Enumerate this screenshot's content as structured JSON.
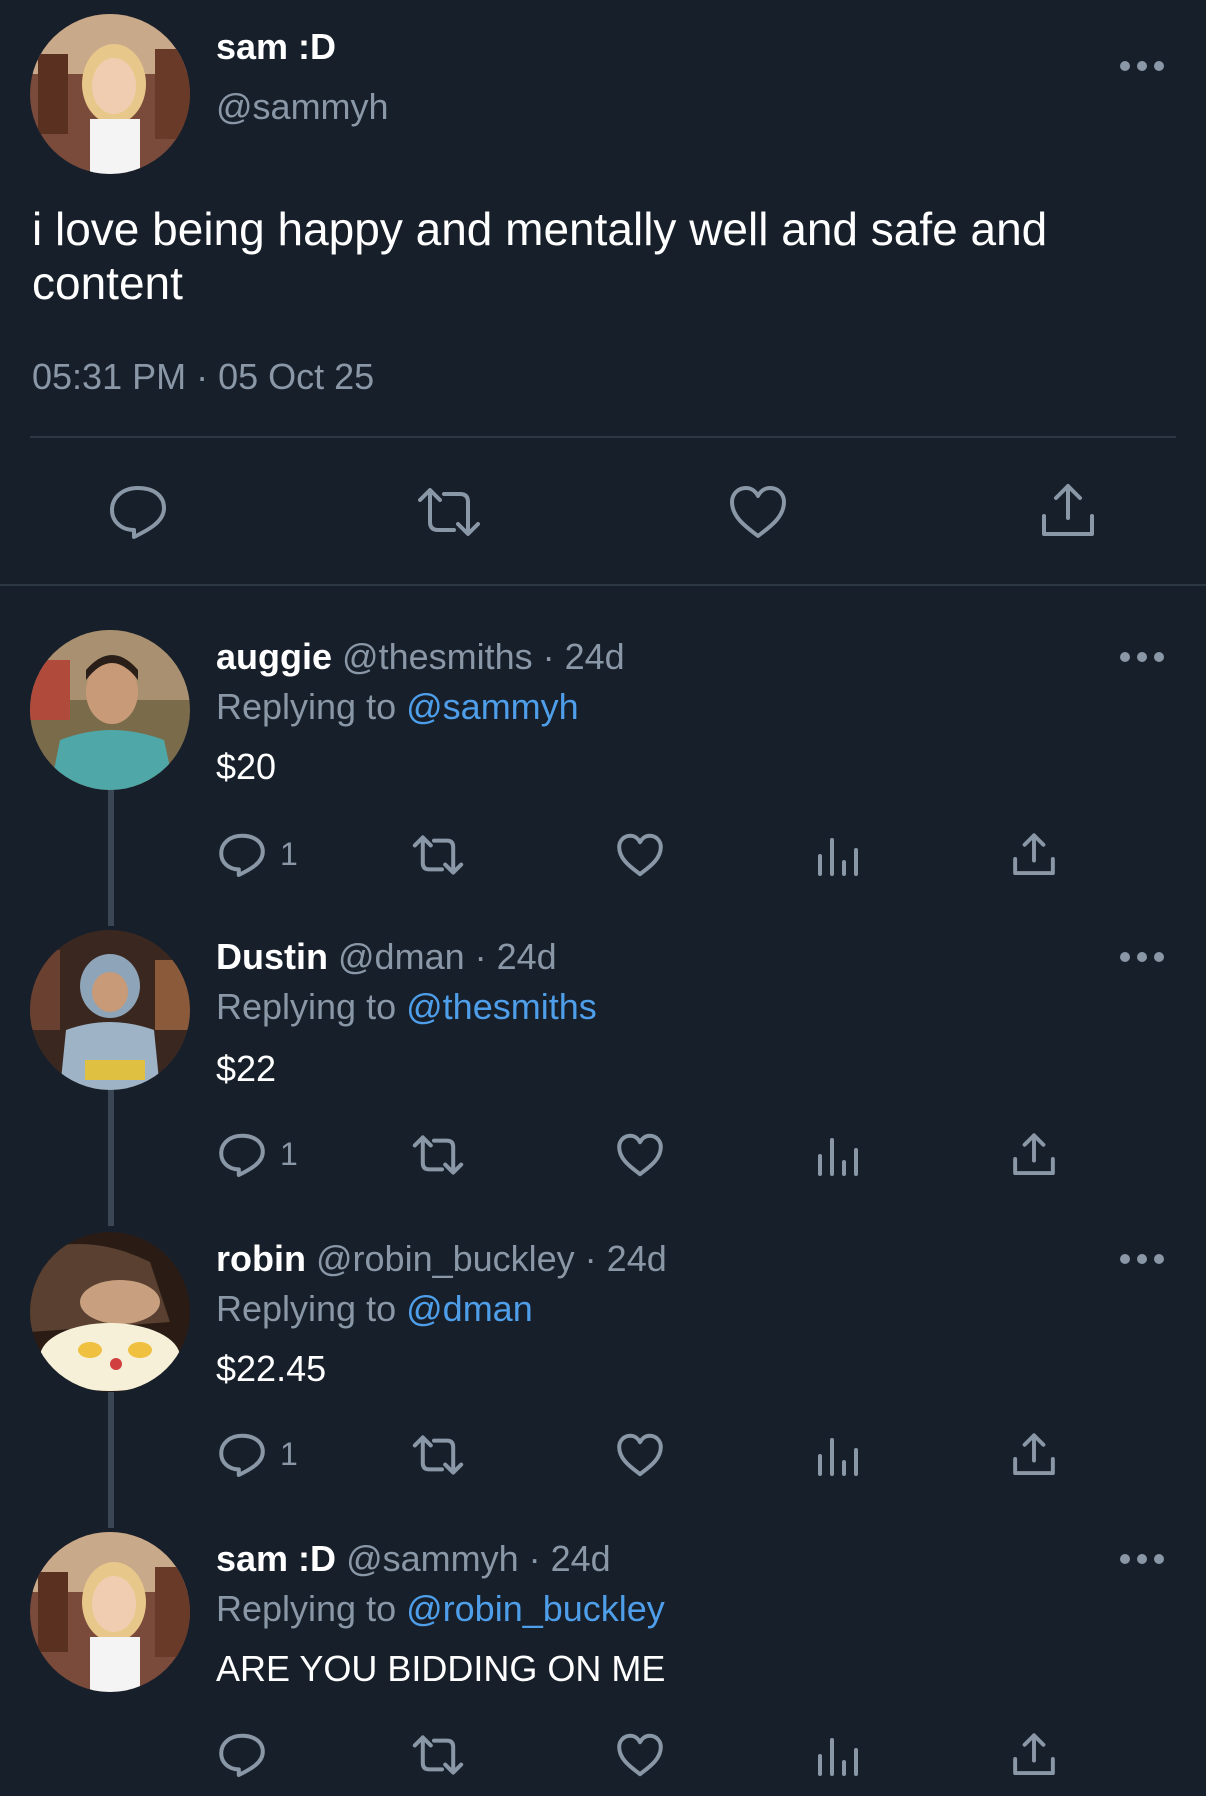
{
  "main_tweet": {
    "display_name": "sam :D",
    "handle": "@sammyh",
    "text_line1": "i love being happy and mentally well and safe and",
    "text_line2": "content",
    "timestamp": "05:31 PM · 05 Oct 25",
    "actions": [
      "reply-icon",
      "retweet-icon",
      "like-icon",
      "share-icon"
    ]
  },
  "replies": [
    {
      "display_name": "auggie",
      "handle_meta": "@thesmiths · 24d",
      "replying_prefix": "Replying to",
      "replying_to": "@sammyh",
      "text": "$20",
      "reply_count": "1"
    },
    {
      "display_name": "Dustin",
      "handle_meta": "@dman · 24d",
      "replying_prefix": "Replying to",
      "replying_to": "@thesmiths",
      "text": "$22",
      "reply_count": "1"
    },
    {
      "display_name": "robin",
      "handle_meta": "@robin_buckley · 24d",
      "replying_prefix": "Replying to",
      "replying_to": "@dman",
      "text": "$22.45",
      "reply_count": "1"
    },
    {
      "display_name": "sam :D",
      "handle_meta": "@sammyh · 24d",
      "replying_prefix": "Replying to",
      "replying_to": "@robin_buckley",
      "text": "ARE YOU BIDDING ON ME",
      "reply_count": ""
    }
  ],
  "colors": {
    "background": "#171f2a",
    "muted": "#8a97a6",
    "link": "#4e9ee9",
    "divider": "#2c3744"
  }
}
